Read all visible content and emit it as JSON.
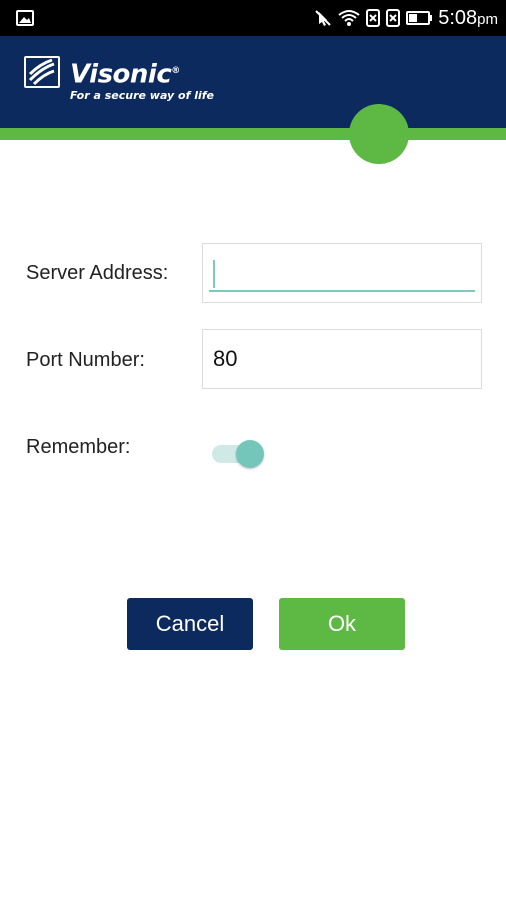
{
  "status_bar": {
    "time": "5:08",
    "ampm": "pm",
    "icons": [
      "image-icon",
      "no-notifications-icon",
      "wifi-icon",
      "sim1-icon",
      "sim2-icon",
      "battery-icon"
    ]
  },
  "header": {
    "brand": "Visonic",
    "trademark": "®",
    "tagline": "For a secure way of life",
    "colors": {
      "navy": "#0d2a5f",
      "green": "#5db944"
    }
  },
  "form": {
    "server_address": {
      "label": "Server Address:",
      "value": ""
    },
    "port_number": {
      "label": "Port Number:",
      "value": "80"
    },
    "remember": {
      "label": "Remember:",
      "enabled": true
    }
  },
  "buttons": {
    "cancel": "Cancel",
    "ok": "Ok"
  }
}
